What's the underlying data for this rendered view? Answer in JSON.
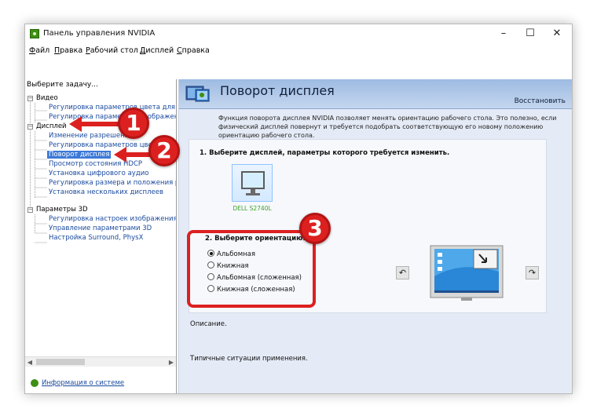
{
  "window": {
    "title": "Панель управления NVIDIA"
  },
  "menu": [
    "Файл",
    "Правка",
    "Рабочий стол",
    "Дисплей",
    "Справка"
  ],
  "left_panel": {
    "header": "Выберите задачу...",
    "tree": [
      {
        "label": "Видео",
        "kind": "top"
      },
      {
        "label": "Регулировка параметров цвета для видео",
        "kind": "link"
      },
      {
        "label": "Регулировка параметров изображения для видео",
        "kind": "link"
      },
      {
        "label": "Дисплей",
        "kind": "top"
      },
      {
        "label": "Изменение разрешения",
        "kind": "link"
      },
      {
        "label": "Регулировка параметров цвета рабочего стола",
        "kind": "link"
      },
      {
        "label": "Поворот дисплея",
        "kind": "selected"
      },
      {
        "label": "Просмотр состояния HDCP",
        "kind": "link"
      },
      {
        "label": "Установка цифрового аудио",
        "kind": "link"
      },
      {
        "label": "Регулировка размера и положения рабочего стола",
        "kind": "link"
      },
      {
        "label": "Установка нескольких дисплеев",
        "kind": "link"
      },
      {
        "label": "Параметры 3D",
        "kind": "top"
      },
      {
        "label": "Регулировка настроек изображения с просмотром",
        "kind": "link"
      },
      {
        "label": "Управление параметрами 3D",
        "kind": "link"
      },
      {
        "label": "Настройка Surround, PhysX",
        "kind": "link"
      }
    ],
    "system_info_link": "Информация о системе"
  },
  "page": {
    "title": "Поворот дисплея",
    "restore_link": "Восстановить",
    "description": "Функция поворота дисплея NVIDIA позволяет менять ориентацию рабочего стола. Это полезно, если физический дисплей повернут и требуется подобрать соответствующую его новому положению ориентацию рабочего стола.",
    "step1": "1. Выберите дисплей, параметры которого требуется изменить.",
    "display_name": "DELL S2740L",
    "step2": "2. Выберите ориентацию.",
    "orientations": [
      "Альбомная",
      "Книжная",
      "Альбомная (сложенная)",
      "Книжная (сложенная)"
    ],
    "selected_orientation": 0,
    "description_label": "Описание.",
    "usage_label": "Типичные ситуации применения."
  },
  "callouts": [
    "1",
    "2",
    "3"
  ],
  "colors": {
    "accent": "#3b78d8",
    "link": "#1a4a9e",
    "callout": "#dc2020",
    "nvidia_green": "#3e8f14",
    "banner": "#a9c4e6"
  }
}
